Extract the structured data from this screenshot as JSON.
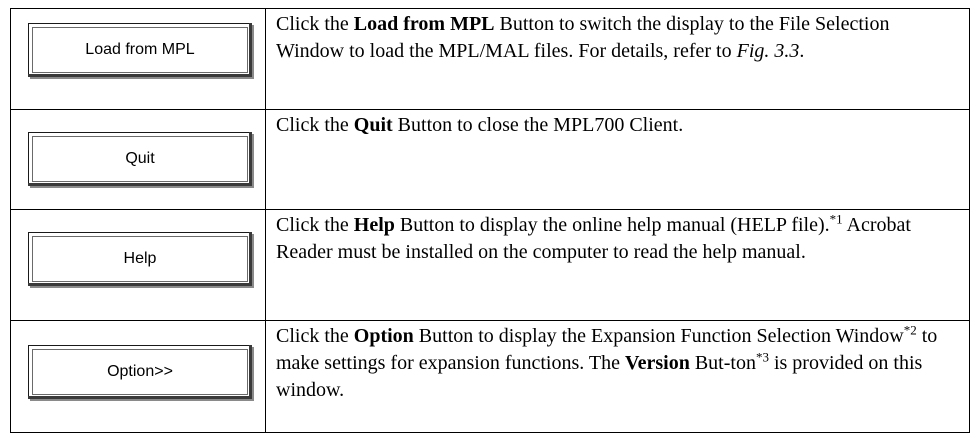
{
  "rows": [
    {
      "button_label": "Load from MPL",
      "text_pre": "Click the ",
      "bold": "Load from MPL",
      "text_post": " Button to switch the display to the File Selection Window to load the MPL/MAL files. For details, refer to ",
      "italic_ref": "Fig. 3.3",
      "text_end": "."
    },
    {
      "button_label": "Quit",
      "text_pre": "Click the ",
      "bold": "Quit",
      "text_post": " Button to close the MPL700 Client."
    },
    {
      "button_label": "Help",
      "text_pre": "Click the ",
      "bold": "Help",
      "text_post": " Button to display the online help manual (HELP file).",
      "footnote": "*1",
      "text_end": " Acrobat Reader must be installed on the computer to read the help manual."
    },
    {
      "button_label": "Option>>",
      "text_pre": "Click the ",
      "bold": "Option",
      "text_post": " Button to display the Expansion Function Selection Window",
      "footnote": "*2",
      "text_mid": " to make settings for expansion functions. The ",
      "bold2": "Version",
      "text_mid2": " But-ton",
      "footnote2": "*3",
      "text_end": " is provided on this window."
    }
  ]
}
